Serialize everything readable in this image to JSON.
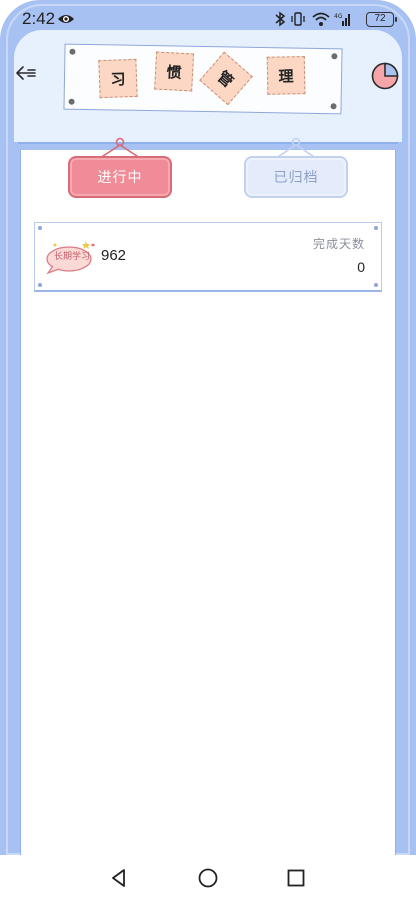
{
  "status_bar": {
    "time": "2:42",
    "battery": "72",
    "icons": [
      "eye-icon",
      "bluetooth-icon",
      "vibrate-icon",
      "wifi-icon",
      "signal-icon",
      "battery-icon"
    ]
  },
  "header": {
    "title_chars": [
      "习",
      "惯",
      "管",
      "理"
    ],
    "back_icon": "back-arrow-icon",
    "stats_icon": "pie-chart-icon"
  },
  "tabs": [
    {
      "label": "进行中",
      "active": true
    },
    {
      "label": "已归档",
      "active": false
    }
  ],
  "habits": [
    {
      "tag": "长期学习",
      "count": "962",
      "days_label": "完成天数",
      "days_value": "0"
    }
  ],
  "nav": {
    "icons": [
      "back-triangle-icon",
      "home-circle-icon",
      "recents-square-icon"
    ]
  },
  "colors": {
    "frame": "#a7c1f3",
    "header_panel": "#e7f0fd",
    "tab_active": "#f08c97",
    "tab_inactive": "#e4ecfb",
    "tile": "#fbd7c4"
  }
}
